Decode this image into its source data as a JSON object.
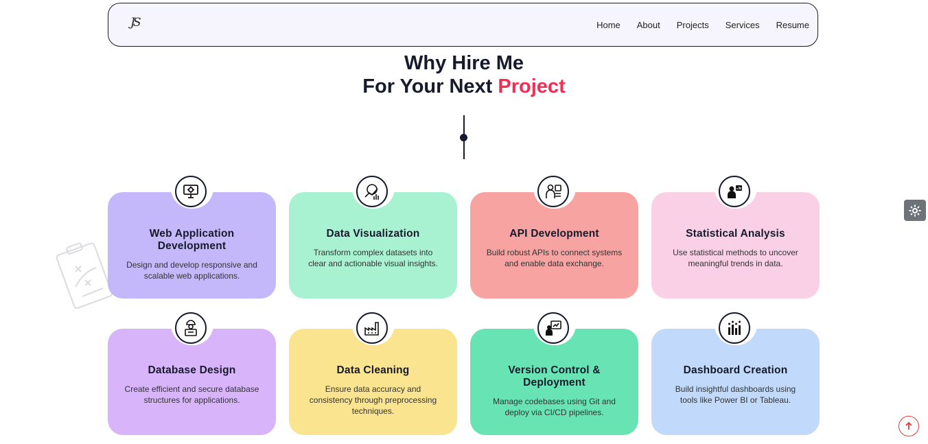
{
  "nav": {
    "logo": "JS",
    "links": [
      "Home",
      "About",
      "Projects",
      "Services",
      "Resume"
    ]
  },
  "hero": {
    "line1": "Why Hire Me",
    "line2_prefix": "For Your Next",
    "line2_accent": "Project"
  },
  "colors": {
    "accent": "#ef2d55",
    "dark": "#161a2b"
  },
  "cards": [
    {
      "title": "Web Application Development",
      "desc": "Design and develop responsive and scalable web applications.",
      "color": "#c4b8fa",
      "icon": "monitor-gear-icon"
    },
    {
      "title": "Data Visualization",
      "desc": "Transform complex datasets into clear and actionable visual insights.",
      "color": "#a8f2d2",
      "icon": "data-chart-icon"
    },
    {
      "title": "API Development",
      "desc": "Build robust APIs to connect systems and enable data exchange.",
      "color": "#f7a3a1",
      "icon": "developer-api-icon"
    },
    {
      "title": "Statistical Analysis",
      "desc": "Use statistical methods to uncover meaningful trends in data.",
      "color": "#f9d0e6",
      "icon": "analyst-presentation-icon"
    },
    {
      "title": "Database Design",
      "desc": "Create efficient and secure database structures for applications.",
      "color": "#d8b5fb",
      "icon": "database-engineer-icon"
    },
    {
      "title": "Data Cleaning",
      "desc": "Ensure data accuracy and consistency through preprocessing techniques.",
      "color": "#fae48f",
      "icon": "factory-icon"
    },
    {
      "title": "Version Control & Deployment",
      "desc": "Manage codebases using Git and deploy via CI/CD pipelines.",
      "color": "#68e4b4",
      "icon": "deployment-presenter-icon"
    },
    {
      "title": "Dashboard Creation",
      "desc": "Build insightful dashboards using tools like Power BI or Tableau.",
      "color": "#c1d9fb",
      "icon": "bar-chart-icon"
    }
  ],
  "floating": {
    "settings_icon": "gear-icon",
    "scroll_icon": "arrow-up-icon"
  }
}
